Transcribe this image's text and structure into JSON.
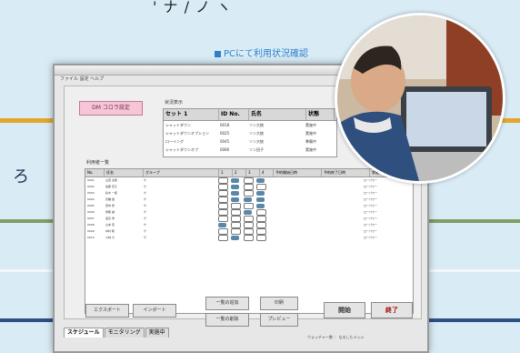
{
  "caption": "PCにて利用状況確認",
  "left_glyph": "ろ",
  "top_fragment": "' ナ / ノ ヽ",
  "window": {
    "menu": "ファイル  設定  ヘルプ",
    "pink_button": "DM コロラ設定",
    "schedule_label": "状況表示",
    "small_table": {
      "headers": [
        "セット 1",
        "ID No.",
        "氏名",
        "状態"
      ],
      "rows": [
        [
          "シャットダウン",
          "0018",
          "ソン大統",
          "実施中"
        ],
        [
          "シャットダウンオプション",
          "0025",
          "ソン大統",
          "実施中"
        ],
        [
          "ローイング",
          "0045",
          "ソン大統",
          "準備中"
        ],
        [
          "シャットダウンオプ",
          "0080",
          "ソン田子",
          "実施中"
        ]
      ]
    },
    "list_label": "利用者一覧",
    "big_table": {
      "headers": [
        "No.",
        "氏名",
        "グループ",
        "1",
        "2",
        "3",
        "4",
        "予約開始日時",
        "予約終了日時",
        "状態"
      ],
      "rows": [
        {
          "no": "0001",
          "name": "山田 太郎",
          "grp": "サ",
          "marks": [
            "o",
            "f",
            "o",
            "f"
          ],
          "st": "ローパワー"
        },
        {
          "no": "0002",
          "name": "佐藤 花子",
          "grp": "サ",
          "marks": [
            "o",
            "f",
            "o",
            "o"
          ],
          "st": "ローパワー"
        },
        {
          "no": "0003",
          "name": "鈴木 一郎",
          "grp": "サ",
          "marks": [
            "o",
            "f",
            "o",
            "f"
          ],
          "st": "ローパワー"
        },
        {
          "no": "0004",
          "name": "高橋 健",
          "grp": "サ",
          "marks": [
            "o",
            "f",
            "f",
            "f"
          ],
          "st": "ローパワー"
        },
        {
          "no": "0005",
          "name": "田中 修",
          "grp": "サ",
          "marks": [
            "o",
            "o",
            "o",
            "f"
          ],
          "st": "ローパワー"
        },
        {
          "no": "0006",
          "name": "伊藤 誠",
          "grp": "サ",
          "marks": [
            "o",
            "o",
            "f",
            "o"
          ],
          "st": "ローパワー"
        },
        {
          "no": "0007",
          "name": "渡辺 学",
          "grp": "サ",
          "marks": [
            "o",
            "o",
            "o",
            "o"
          ],
          "st": "ローパワー"
        },
        {
          "no": "0008",
          "name": "山本 恵",
          "grp": "サ",
          "marks": [
            "f",
            "o",
            "o",
            "o"
          ],
          "st": "ローパワー"
        },
        {
          "no": "0009",
          "name": "中村 聡",
          "grp": "サ",
          "marks": [
            "o",
            "o",
            "o",
            "o"
          ],
          "st": "ローパワー"
        },
        {
          "no": "0010",
          "name": "小林 大",
          "grp": "サ",
          "marks": [
            "o",
            "f",
            "o",
            "o"
          ],
          "st": "ローパワー"
        }
      ]
    },
    "buttons": {
      "b1": "エクスポート",
      "b2": "インポート",
      "b3": "一覧の追加",
      "b4": "一覧の削除",
      "b5": "印刷",
      "b6": "プレビュー",
      "start": "開始",
      "end": "終了"
    },
    "status": "ウォッチャー数 ：  なるしたメッシ",
    "tabs": [
      "スケジュール",
      "モニタリング",
      "実施中"
    ]
  }
}
